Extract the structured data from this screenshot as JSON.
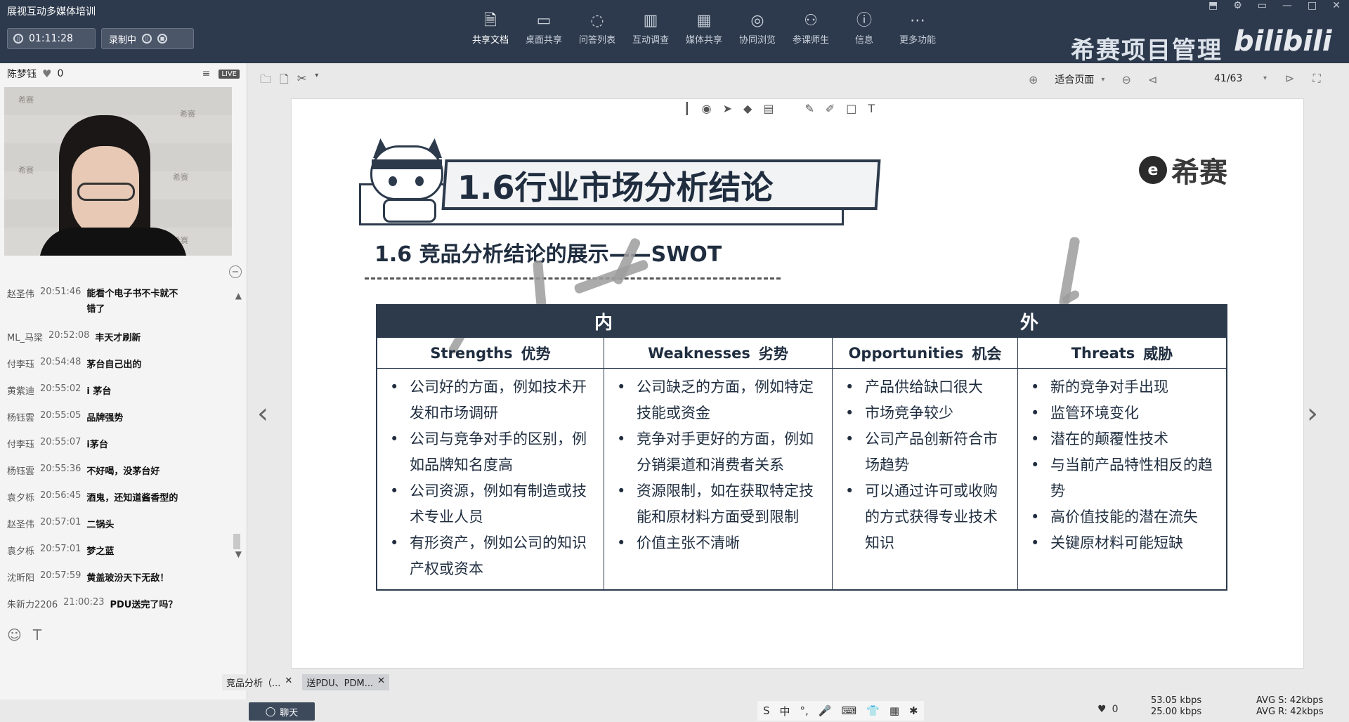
{
  "window": {
    "app_title": "展视互动多媒体培训",
    "timer": "01:11:28",
    "recording_label": "录制中"
  },
  "toolbar": {
    "items": [
      {
        "label": "共享文档",
        "icon": "document-icon"
      },
      {
        "label": "桌面共享",
        "icon": "desktop-icon"
      },
      {
        "label": "问答列表",
        "icon": "qa-icon"
      },
      {
        "label": "互动调查",
        "icon": "survey-icon"
      },
      {
        "label": "媒体共享",
        "icon": "film-icon"
      },
      {
        "label": "协同浏览",
        "icon": "compass-icon"
      },
      {
        "label": "参课师生",
        "icon": "people-icon"
      },
      {
        "label": "信息",
        "icon": "info-icon"
      },
      {
        "label": "更多功能",
        "icon": "more-icon"
      }
    ],
    "brand_text": "希赛项目管理",
    "bili_text": "bilibili"
  },
  "presenter": {
    "name": "陈梦钰",
    "likes": "0",
    "live_badge": "LIVE"
  },
  "video": {
    "watermark": "希赛"
  },
  "chat": {
    "messages": [
      {
        "who": "赵圣伟",
        "when": "20:51:46",
        "text": "能看个电子书不卡就不错了"
      },
      {
        "who": "ML_马梁",
        "when": "20:52:08",
        "text": "丰天才刷新"
      },
      {
        "who": "付李珏",
        "when": "20:54:48",
        "text": "茅台自己出的"
      },
      {
        "who": "黄紫迪",
        "when": "20:55:02",
        "text": "i 茅台"
      },
      {
        "who": "杨钰雲",
        "when": "20:55:05",
        "text": "品牌强势"
      },
      {
        "who": "付李珏",
        "when": "20:55:07",
        "text": "i茅台"
      },
      {
        "who": "杨钰雲",
        "when": "20:55:36",
        "text": "不好喝，没茅台好"
      },
      {
        "who": "袁夕栎",
        "when": "20:56:45",
        "text": "酒鬼，还知道酱香型的"
      },
      {
        "who": "赵圣伟",
        "when": "20:57:01",
        "text": "二锅头"
      },
      {
        "who": "袁夕栎",
        "when": "20:57:01",
        "text": "梦之蓝"
      },
      {
        "who": "沈昕阳",
        "when": "20:57:59",
        "text": "黄盖玻汾天下无敌！"
      },
      {
        "who": "朱新力2206",
        "when": "21:00:23",
        "text": "PDU送完了吗？"
      }
    ]
  },
  "doc": {
    "zoom_label": "适合页面",
    "page_indicator": "41/63"
  },
  "slide": {
    "title": "1.6行业市场分析结论",
    "logo_text": "希赛",
    "subtitle": "1.6 竞品分析结论的展示——SWOT",
    "inner_label": "内",
    "outer_label": "外",
    "columns": [
      {
        "en": "Strengths",
        "cn": "优势",
        "items": [
          "公司好的方面，例如技术开发和市场调研",
          "公司与竞争对手的区别，例如品牌知名度高",
          "公司资源，例如有制造或技术专业人员",
          "有形资产，例如公司的知识产权或资本"
        ]
      },
      {
        "en": "Weaknesses",
        "cn": "劣势",
        "items": [
          "公司缺乏的方面，例如特定技能或资金",
          "竞争对手更好的方面，例如分销渠道和消费者关系",
          "资源限制，如在获取特定技能和原材料方面受到限制",
          "价值主张不清晰"
        ]
      },
      {
        "en": "Opportunities",
        "cn": "机会",
        "items": [
          "产品供给缺口很大",
          "市场竞争较少",
          "公司产品创新符合市场趋势",
          "可以通过许可或收购的方式获得专业技术知识"
        ]
      },
      {
        "en": "Threats",
        "cn": "威胁",
        "items": [
          "新的竞争对手出现",
          "监管环境变化",
          "潜在的颠覆性技术",
          "与当前产品特性相反的趋势",
          "高价值技能的潜在流失",
          "关键原材料可能短缺"
        ]
      }
    ]
  },
  "bottom": {
    "tabs": [
      "竞品分析（...",
      "送PDU、PDM..."
    ],
    "chat_button": "聊天",
    "ime_lang": "中",
    "likes": "0",
    "up_rate": "53.05 kbps",
    "down_rate": "25.00 kbps",
    "avg_s": "AVG S: 42kbps",
    "avg_r": "AVG R: 42kbps"
  },
  "colors": {
    "topbar": "#2d3a4d",
    "slide_navy": "#2c3a4c"
  }
}
